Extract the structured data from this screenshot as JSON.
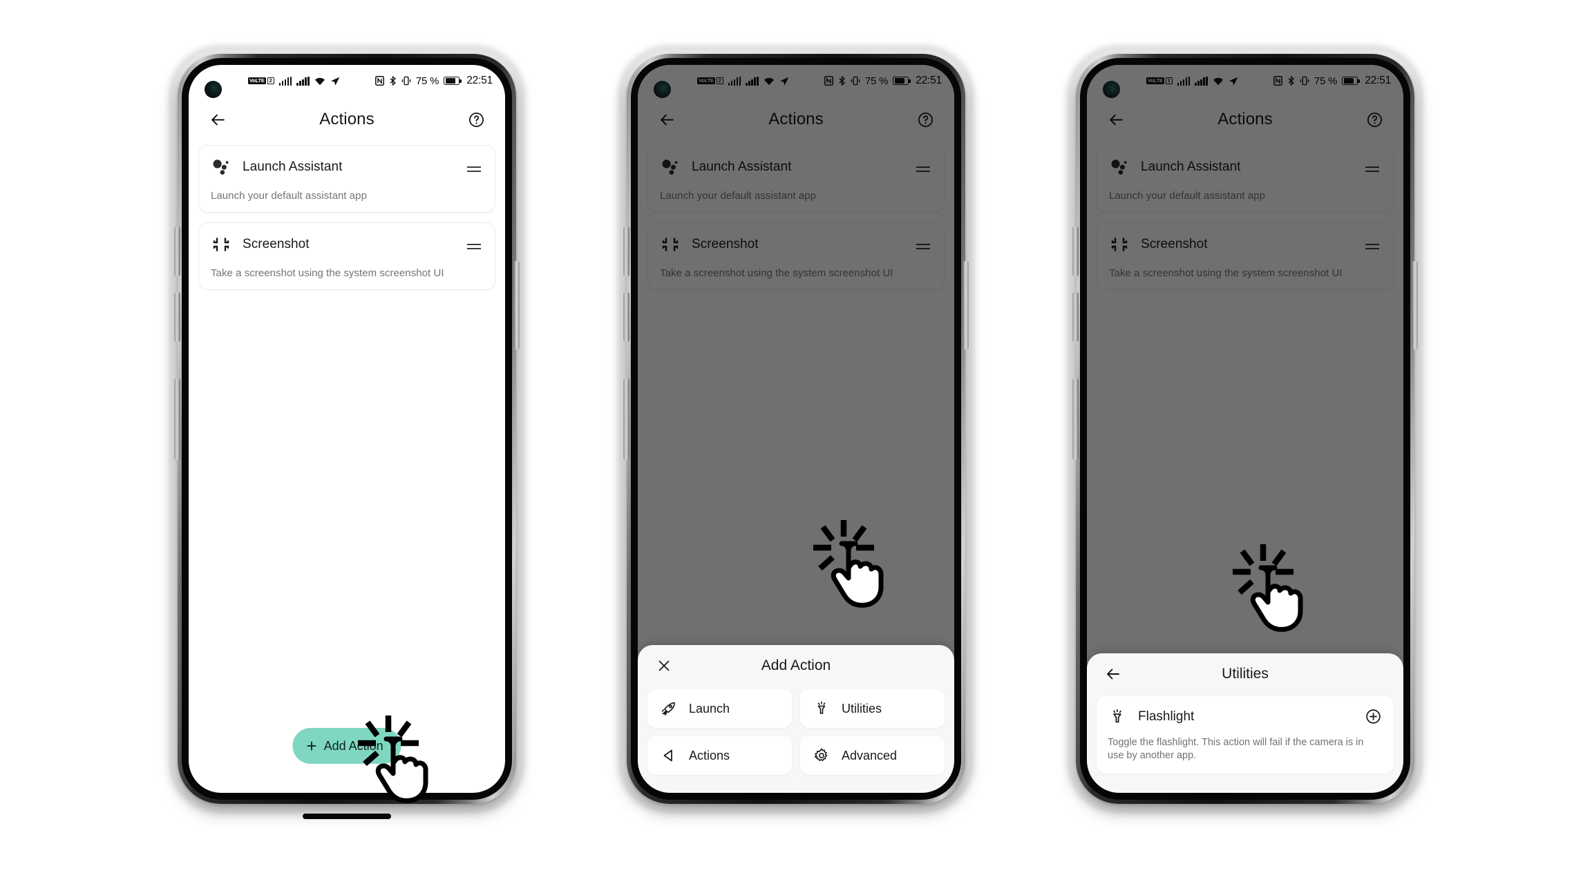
{
  "theme": {
    "accent": "#7fd7c2",
    "scrim": "#000000",
    "text_primary": "#17191b",
    "text_secondary": "#707478"
  },
  "status_bar": {
    "volte_label": "VoLTE",
    "sim_label": "2",
    "battery_percent": "75 %",
    "time": "22:51",
    "icons": [
      "volte-icon",
      "sim2-icon",
      "signal-bars-icon",
      "signal-bars-icon",
      "wifi-icon",
      "location-icon",
      "nfc-icon",
      "bluetooth-icon",
      "vibrate-icon",
      "battery-icon"
    ]
  },
  "app_bar": {
    "title": "Actions",
    "back_icon": "back-arrow-icon",
    "help_icon": "help-circle-icon"
  },
  "actions": [
    {
      "icon": "assistant-dots-icon",
      "title": "Launch Assistant",
      "description": "Launch your default assistant app",
      "handle_icon": "drag-handle-icon"
    },
    {
      "icon": "screenshot-crop-icon",
      "title": "Screenshot",
      "description": "Take a screenshot using the system screenshot UI",
      "handle_icon": "drag-handle-icon"
    }
  ],
  "fab": {
    "label": "Add Action",
    "plus": "+",
    "icon": "plus-icon"
  },
  "add_action_sheet": {
    "title": "Add Action",
    "close_icon": "close-x-icon",
    "options": [
      {
        "label": "Launch",
        "icon": "rocket-icon"
      },
      {
        "label": "Utilities",
        "icon": "flashlight-icon"
      },
      {
        "label": "Actions",
        "icon": "play-left-triangle-icon"
      },
      {
        "label": "Advanced",
        "icon": "gear-icon"
      }
    ]
  },
  "utilities_sheet": {
    "title": "Utilities",
    "back_icon": "back-arrow-icon",
    "items": [
      {
        "icon": "flashlight-icon",
        "title": "Flashlight",
        "description": "Toggle the flashlight. This action will fail if the camera is in use by another app.",
        "add_icon": "plus-circle-icon"
      }
    ]
  },
  "cursors": {
    "phone1_target": "Add Action",
    "phone2_target": "Utilities",
    "phone3_target": "Flashlight"
  }
}
